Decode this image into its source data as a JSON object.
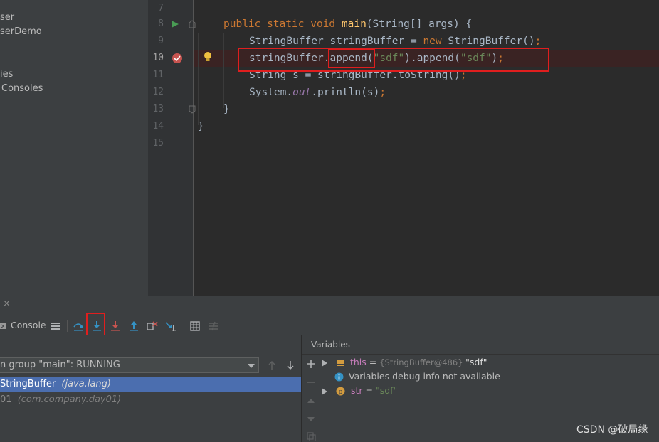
{
  "project_tree": {
    "items": [
      "ser",
      "serDemo",
      "ies",
      "Consoles"
    ]
  },
  "editor": {
    "line_numbers": [
      "7",
      "8",
      "9",
      "10",
      "11",
      "12",
      "13",
      "14",
      "15"
    ],
    "code": {
      "l8": {
        "kw1": "public static void ",
        "fn": "main",
        "rest": "(String[] args) {"
      },
      "l9": {
        "a": "StringBuffer stringBuffer = ",
        "kw": "new ",
        "b": "StringBuffer()",
        "semi": ";"
      },
      "l10": {
        "a": "stringBuffer.append(",
        "s1": "\"sdf\"",
        "b": ").append(",
        "s2": "\"sdf\"",
        "c": ")",
        "semi": ";"
      },
      "l11": {
        "a": "String s = stringBuffer.toString()",
        "semi": ";"
      },
      "l12": {
        "a": "System.",
        "fld": "out",
        "b": ".println(s)",
        "semi": ";"
      },
      "l13": {
        "a": "}"
      },
      "l14": {
        "a": "}"
      }
    }
  },
  "debug": {
    "close_glyph": "×",
    "console_tab": "Console",
    "thread_select": "n group \"main\": RUNNING",
    "frames": [
      {
        "name": "StringBuffer",
        "pkg": "(java.lang)"
      },
      {
        "name": "01",
        "pkg": "(com.company.day01)"
      }
    ],
    "variables_title": "Variables",
    "variables": [
      {
        "name": "this",
        "eq": " = ",
        "type": "{StringBuffer@486} ",
        "value": "\"sdf\""
      },
      {
        "name": "Variables debug info not available"
      },
      {
        "name": "str",
        "eq": " = ",
        "value": "\"sdf\""
      }
    ]
  },
  "watermark": "CSDN @破局缘",
  "colors": {
    "accent": "#4b6eaf",
    "breakpoint": "#c75450",
    "highlight_box": "#e01e1e",
    "selected_frame": "#4b6eaf"
  }
}
